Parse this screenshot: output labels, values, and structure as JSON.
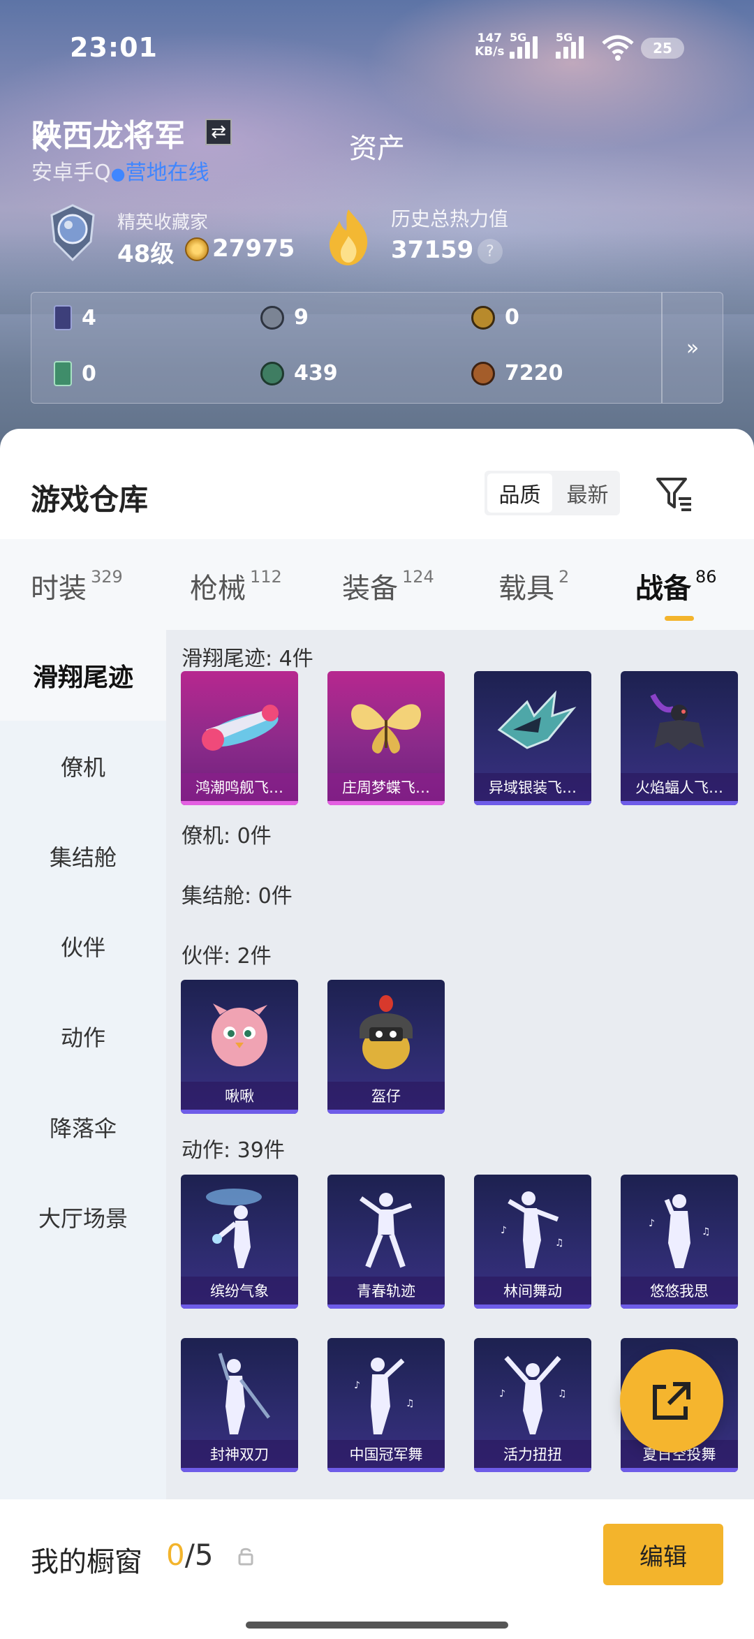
{
  "status_bar": {
    "time": "23:01",
    "net_speed_value": "147",
    "net_speed_unit": "KB/s",
    "signal1_tag": "5G",
    "signal2_tag": "5G",
    "wifi_tag": "6",
    "battery": "25"
  },
  "header": {
    "page_title": "资产",
    "user_name": "陕西龙将军",
    "platform": "安卓手Q",
    "online_status": "营地在线",
    "level_label": "精英收藏家",
    "level_value": "48级",
    "coins": "27975",
    "heat_label": "历史总热力值",
    "heat_value": "37159",
    "help_icon": "?"
  },
  "assets": [
    {
      "icon": "card-icon",
      "value": "4",
      "color": "#3d3f7a"
    },
    {
      "icon": "silver-coin-icon",
      "value": "9",
      "color": "#7b8494"
    },
    {
      "icon": "gold-coin-icon",
      "value": "0",
      "color": "#b88a2c"
    },
    {
      "icon": "green-card-icon",
      "value": "0",
      "color": "#3f8d6a"
    },
    {
      "icon": "jade-coin-icon",
      "value": "439",
      "color": "#3f7d62"
    },
    {
      "icon": "bronze-coin-icon",
      "value": "7220",
      "color": "#a45d2a"
    }
  ],
  "assets_more": "»",
  "warehouse": {
    "title": "游戏仓库",
    "sort_quality": "品质",
    "sort_newest": "最新"
  },
  "tabs": [
    {
      "label": "时装",
      "count": "329"
    },
    {
      "label": "枪械",
      "count": "112"
    },
    {
      "label": "装备",
      "count": "124"
    },
    {
      "label": "载具",
      "count": "2"
    },
    {
      "label": "战备",
      "count": "86",
      "active": true
    }
  ],
  "sidebar": [
    {
      "label": "滑翔尾迹",
      "active": true
    },
    {
      "label": "僚机"
    },
    {
      "label": "集结舱"
    },
    {
      "label": "伙伴"
    },
    {
      "label": "动作"
    },
    {
      "label": "降落伞"
    },
    {
      "label": "大厅场景"
    }
  ],
  "sections": {
    "glide": {
      "title": "滑翔尾迹: 4件",
      "items": [
        "鸿潮鸣舰飞…",
        "庄周梦蝶飞…",
        "异域银装飞…",
        "火焰蝠人飞…"
      ]
    },
    "wingman": {
      "title": "僚机: 0件"
    },
    "capsule": {
      "title": "集结舱: 0件"
    },
    "partner": {
      "title": "伙伴: 2件",
      "items": [
        "啾啾",
        "盔仔"
      ]
    },
    "emote": {
      "title": "动作: 39件",
      "items": [
        "缤纷气象",
        "青春轨迹",
        "林间舞动",
        "悠悠我思",
        "封神双刀",
        "中国冠军舞",
        "活力扭扭",
        "夏日空投舞"
      ]
    }
  },
  "showcase": {
    "title": "我的橱窗",
    "current": "0",
    "total": "/5",
    "edit_label": "编辑"
  },
  "colors": {
    "accent": "#f3b42c",
    "online": "#3f86ff"
  }
}
